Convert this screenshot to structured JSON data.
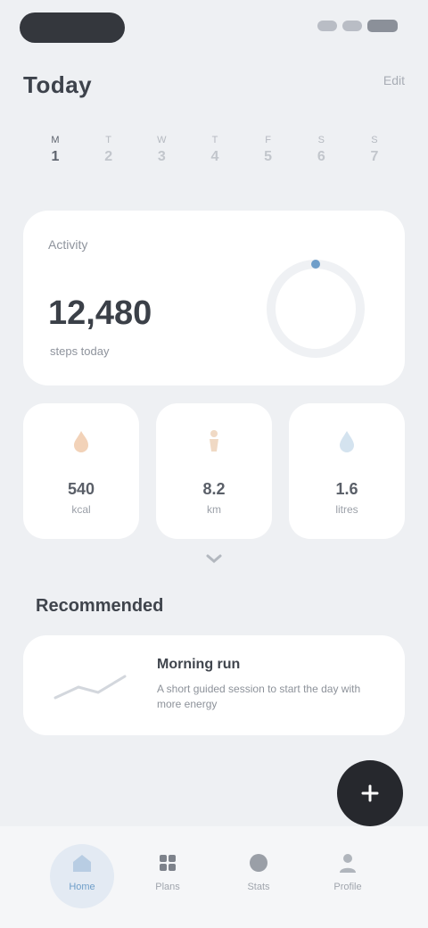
{
  "status_bar": {
    "time": "",
    "battery": ""
  },
  "header": {
    "title": "Today",
    "action": "Edit"
  },
  "week": {
    "days": [
      {
        "name": "M",
        "num": "1"
      },
      {
        "name": "T",
        "num": "2"
      },
      {
        "name": "W",
        "num": "3"
      },
      {
        "name": "T",
        "num": "4"
      },
      {
        "name": "F",
        "num": "5"
      },
      {
        "name": "S",
        "num": "6"
      },
      {
        "name": "S",
        "num": "7"
      }
    ]
  },
  "summary": {
    "label": "Activity",
    "value": "12,480",
    "sub": "steps today",
    "progress": 0.0
  },
  "metrics": [
    {
      "icon": "flame-icon",
      "value": "540",
      "label": "kcal"
    },
    {
      "icon": "figure-icon",
      "value": "8.2",
      "label": "km"
    },
    {
      "icon": "drop-icon",
      "value": "1.6",
      "label": "litres"
    }
  ],
  "more_icon": "chevron-down-icon",
  "section": {
    "title": "Recommended"
  },
  "article": {
    "title": "Morning run",
    "desc": "A short guided session to start the day with more energy"
  },
  "fab": {
    "icon": "plus-icon"
  },
  "tabs": [
    {
      "label": "Home",
      "icon": "home-icon"
    },
    {
      "label": "Plans",
      "icon": "grid-icon"
    },
    {
      "label": "Stats",
      "icon": "chart-icon"
    },
    {
      "label": "Profile",
      "icon": "person-icon"
    }
  ],
  "colors": {
    "accent": "#6f9ec9",
    "background": "#eef0f3",
    "card": "#ffffff",
    "fab": "#26282d"
  }
}
